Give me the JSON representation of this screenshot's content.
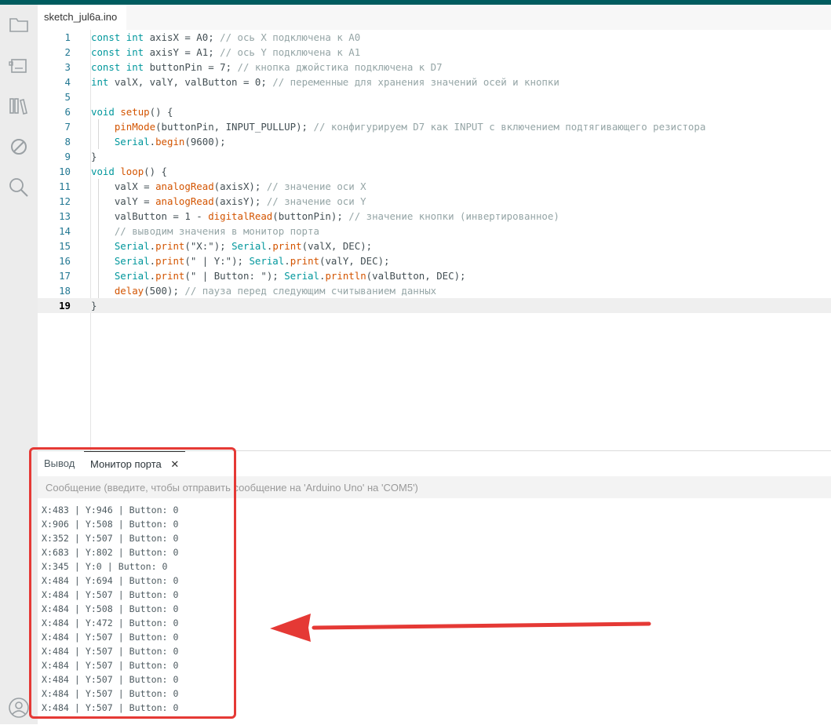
{
  "window": {
    "accent": "#005c5f"
  },
  "sidebar": {
    "items": [
      {
        "icon": "folder-icon"
      },
      {
        "icon": "board-icon"
      },
      {
        "icon": "library-icon"
      },
      {
        "icon": "debug-icon"
      },
      {
        "icon": "search-icon"
      }
    ],
    "bottom_icon": "user-icon"
  },
  "file_tab": {
    "label": "sketch_jul6a.ino"
  },
  "editor": {
    "active_line": 19,
    "lines": [
      {
        "n": "1",
        "segs": [
          [
            "kw",
            "const int"
          ],
          [
            "",
            " axisX = A0; "
          ],
          [
            "cm",
            "// ось X подключена к A0"
          ]
        ]
      },
      {
        "n": "2",
        "segs": [
          [
            "kw",
            "const int"
          ],
          [
            "",
            " axisY = A1; "
          ],
          [
            "cm",
            "// ось Y подключена к A1"
          ]
        ]
      },
      {
        "n": "3",
        "segs": [
          [
            "kw",
            "const int"
          ],
          [
            "",
            " buttonPin = 7; "
          ],
          [
            "cm",
            "// кнопка джойстика подключена к D7"
          ]
        ]
      },
      {
        "n": "4",
        "segs": [
          [
            "kw",
            "int"
          ],
          [
            "",
            " valX, valY, valButton = 0; "
          ],
          [
            "cm",
            "// переменные для хранения значений осей и кнопки"
          ]
        ]
      },
      {
        "n": "5",
        "segs": []
      },
      {
        "n": "6",
        "segs": [
          [
            "kw",
            "void"
          ],
          [
            "",
            " "
          ],
          [
            "fn",
            "setup"
          ],
          [
            "",
            "() {"
          ]
        ]
      },
      {
        "n": "7",
        "segs": [
          [
            "",
            "    "
          ],
          [
            "fn",
            "pinMode"
          ],
          [
            "",
            "(buttonPin, INPUT_PULLUP); "
          ],
          [
            "cm",
            "// конфигурируем D7 как INPUT с включением подтягивающего резистора"
          ]
        ]
      },
      {
        "n": "8",
        "segs": [
          [
            "",
            "    "
          ],
          [
            "kw",
            "Serial"
          ],
          [
            "",
            "."
          ],
          [
            "fn",
            "begin"
          ],
          [
            "",
            "(9600);"
          ]
        ]
      },
      {
        "n": "9",
        "segs": [
          [
            "",
            "}"
          ]
        ]
      },
      {
        "n": "10",
        "segs": [
          [
            "kw",
            "void"
          ],
          [
            "",
            " "
          ],
          [
            "fn",
            "loop"
          ],
          [
            "",
            "() {"
          ]
        ]
      },
      {
        "n": "11",
        "segs": [
          [
            "",
            "    valX = "
          ],
          [
            "fn",
            "analogRead"
          ],
          [
            "",
            "(axisX); "
          ],
          [
            "cm",
            "// значение оси X"
          ]
        ]
      },
      {
        "n": "12",
        "segs": [
          [
            "",
            "    valY = "
          ],
          [
            "fn",
            "analogRead"
          ],
          [
            "",
            "(axisY); "
          ],
          [
            "cm",
            "// значение оси Y"
          ]
        ]
      },
      {
        "n": "13",
        "segs": [
          [
            "",
            "    valButton = 1 - "
          ],
          [
            "fn",
            "digitalRead"
          ],
          [
            "",
            "(buttonPin); "
          ],
          [
            "cm",
            "// значение кнопки (инвертированное)"
          ]
        ]
      },
      {
        "n": "14",
        "segs": [
          [
            "",
            "    "
          ],
          [
            "cm",
            "// выводим значения в монитор порта"
          ]
        ]
      },
      {
        "n": "15",
        "segs": [
          [
            "",
            "    "
          ],
          [
            "kw",
            "Serial"
          ],
          [
            "",
            "."
          ],
          [
            "fn",
            "print"
          ],
          [
            "",
            "(\"X:\"); "
          ],
          [
            "kw",
            "Serial"
          ],
          [
            "",
            "."
          ],
          [
            "fn",
            "print"
          ],
          [
            "",
            "(valX, DEC);"
          ]
        ]
      },
      {
        "n": "16",
        "segs": [
          [
            "",
            "    "
          ],
          [
            "kw",
            "Serial"
          ],
          [
            "",
            "."
          ],
          [
            "fn",
            "print"
          ],
          [
            "",
            "(\" | Y:\"); "
          ],
          [
            "kw",
            "Serial"
          ],
          [
            "",
            "."
          ],
          [
            "fn",
            "print"
          ],
          [
            "",
            "(valY, DEC);"
          ]
        ]
      },
      {
        "n": "17",
        "segs": [
          [
            "",
            "    "
          ],
          [
            "kw",
            "Serial"
          ],
          [
            "",
            "."
          ],
          [
            "fn",
            "print"
          ],
          [
            "",
            "(\" | Button: \"); "
          ],
          [
            "kw",
            "Serial"
          ],
          [
            "",
            "."
          ],
          [
            "fn",
            "println"
          ],
          [
            "",
            "(valButton, DEC);"
          ]
        ]
      },
      {
        "n": "18",
        "segs": [
          [
            "",
            "    "
          ],
          [
            "fn",
            "delay"
          ],
          [
            "",
            "(500); "
          ],
          [
            "cm",
            "// пауза перед следующим считыванием данных"
          ]
        ]
      },
      {
        "n": "19",
        "segs": [
          [
            "",
            "}"
          ]
        ]
      }
    ]
  },
  "bottom_panel": {
    "tabs": [
      {
        "label": "Вывод",
        "active": false
      },
      {
        "label": "Монитор порта",
        "active": true
      }
    ],
    "message_input": {
      "placeholder": "Сообщение (введите, чтобы отправить сообщение на 'Arduino Uno' на 'COM5')",
      "value": ""
    },
    "serial_output": [
      "X:483 | Y:946 | Button: 0",
      "X:906 | Y:508 | Button: 0",
      "X:352 | Y:507 | Button: 0",
      "X:683 | Y:802 | Button: 0",
      "X:345 | Y:0 | Button: 0",
      "X:484 | Y:694 | Button: 0",
      "X:484 | Y:507 | Button: 0",
      "X:484 | Y:508 | Button: 0",
      "X:484 | Y:472 | Button: 0",
      "X:484 | Y:507 | Button: 0",
      "X:484 | Y:507 | Button: 0",
      "X:484 | Y:507 | Button: 0",
      "X:484 | Y:507 | Button: 0",
      "X:484 | Y:507 | Button: 0",
      "X:484 | Y:507 | Button: 0"
    ]
  },
  "annotation": {
    "color": "#e53935",
    "arrow_icon": "red-arrow-left"
  }
}
